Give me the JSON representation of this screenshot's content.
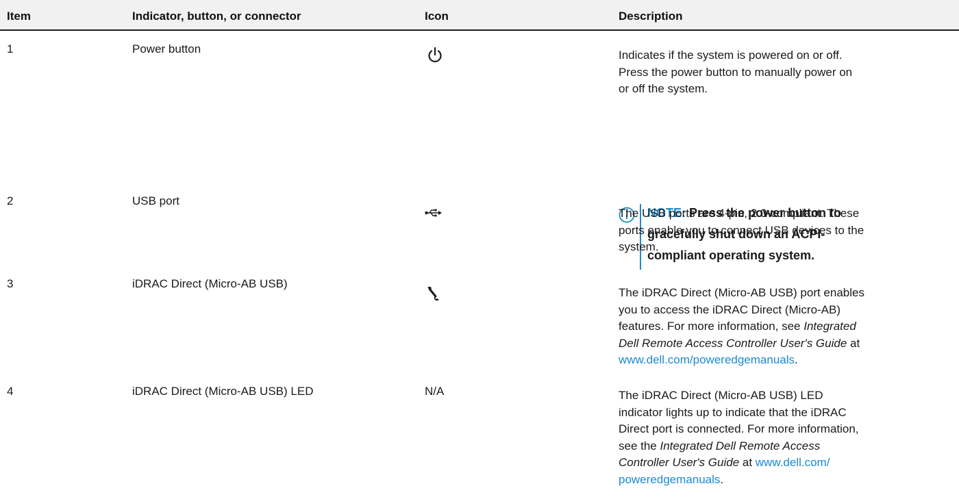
{
  "table": {
    "headers": {
      "item": "Item",
      "name": "Indicator, button, or connector",
      "icon": "Icon",
      "description": "Description"
    },
    "rows": [
      {
        "item": "1",
        "name": "Power button",
        "icon": "power-icon",
        "description": {
          "line1": "Indicates if the system is powered on or off.",
          "line2": "Press the power button to manually power on",
          "line3": "or off the system."
        },
        "note": {
          "label": "NOTE:",
          "text1": "Press the power button to",
          "text2": "gracefully shut down an ACPI-",
          "text3": "compliant operating system."
        }
      },
      {
        "item": "2",
        "name": "USB port",
        "icon": "usb-icon",
        "description": {
          "line1": "The USB ports are 4-pin, 2.0-compliant. These",
          "line2": "ports enable you to connect USB devices to the",
          "line3": "system."
        }
      },
      {
        "item": "3",
        "name": "iDRAC Direct (Micro-AB USB)",
        "icon": "wrench-icon",
        "description": {
          "line1": "The iDRAC Direct (Micro-AB USB) port enables",
          "line2": "you to access the iDRAC Direct (Micro-AB)",
          "line3_a": "features. For more information, see ",
          "line3_em": "Integrated",
          "line4_em": "Dell Remote Access Controller User's Guide",
          "line4_b": " at",
          "link": "www.dell.com/poweredgemanuals",
          "line5_tail": "."
        }
      },
      {
        "item": "4",
        "name": "iDRAC Direct (Micro-AB USB) LED",
        "icon_text": "N/A",
        "description": {
          "line1": "The iDRAC Direct (Micro-AB USB) LED",
          "line2": "indicator lights up to indicate that the iDRAC",
          "line3": "Direct port is connected. For more information,",
          "line4_a": "see the ",
          "line4_em": "Integrated Dell Remote Access",
          "line5_em": "Controller User's Guide",
          "line5_b": " at ",
          "link_part1": "www.dell.com/",
          "link_part2": "poweredgemanuals",
          "line6_tail": "."
        }
      }
    ]
  },
  "colors": {
    "link": "#1a8bd0",
    "note_accent": "#1a8bd0",
    "header_bg": "#f1f1f1"
  }
}
